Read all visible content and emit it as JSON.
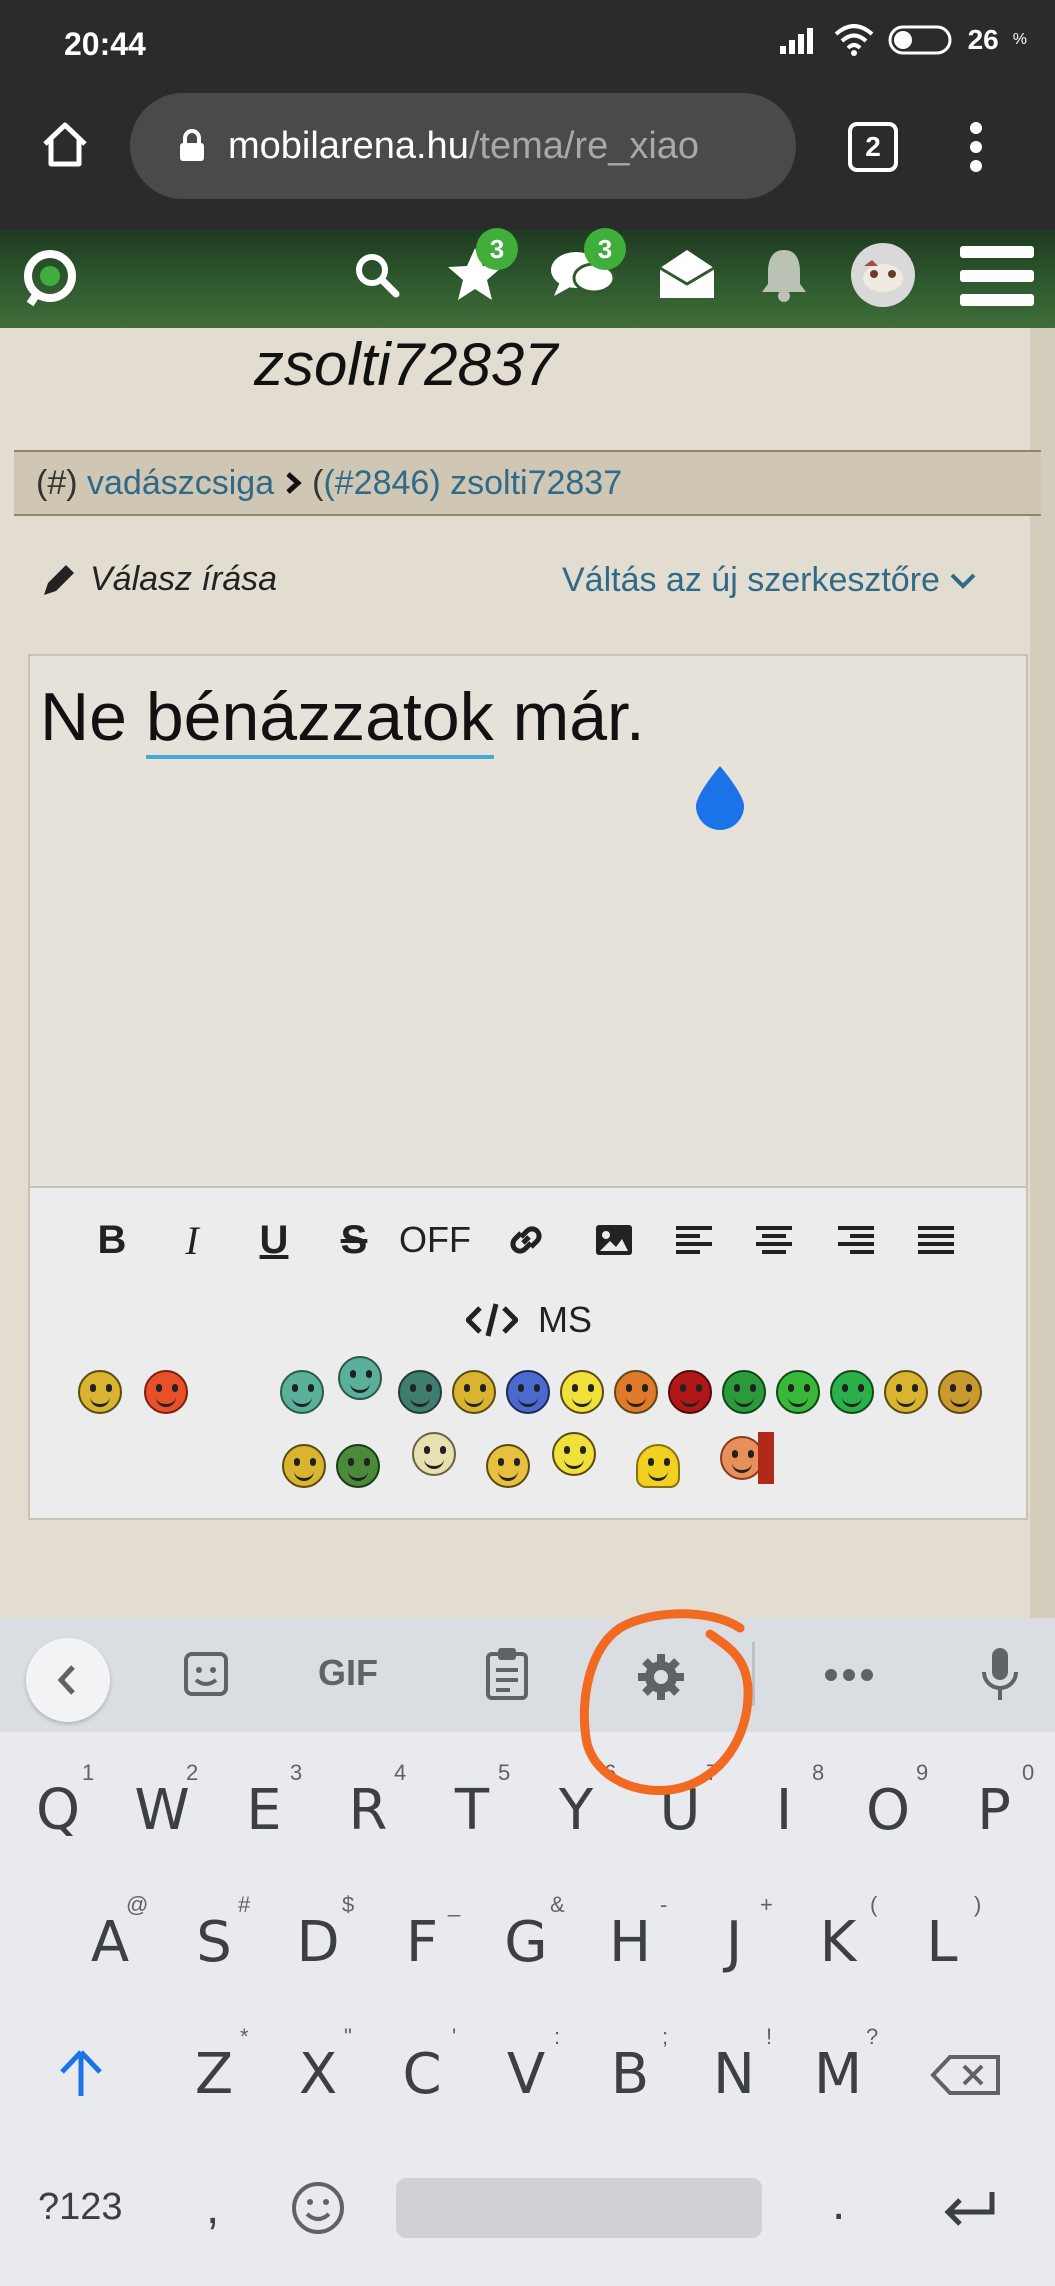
{
  "status_bar": {
    "time": "20:44",
    "battery": "26"
  },
  "browser": {
    "url_host": "mobilarena.hu",
    "url_path": "/tema/re_xiao",
    "tab_count": "2"
  },
  "site_header": {
    "favorites_badge": "3",
    "messages_badge": "3"
  },
  "page": {
    "username_title": "zsolti72837",
    "breadcrumb": {
      "hash_prefix": "(#)",
      "author": "vadászcsiga",
      "post_ref": "(#2846)",
      "reply_to": "zsolti72837"
    },
    "reply_label": "Válasz írása",
    "switch_editor_label": "Váltás az új szerkesztőre",
    "editor": {
      "word1": "Ne",
      "word2": "bénázzatok",
      "word3": "már."
    },
    "toolbar": {
      "off_label": "OFF",
      "ms_label": "MS"
    }
  },
  "keyboard": {
    "toolbar_gif": "GIF",
    "row1": [
      "Q",
      "W",
      "E",
      "R",
      "T",
      "Y",
      "U",
      "I",
      "O",
      "P"
    ],
    "row1_hints": [
      "1",
      "2",
      "3",
      "4",
      "5",
      "6",
      "7",
      "8",
      "9",
      "0"
    ],
    "row2": [
      "A",
      "S",
      "D",
      "F",
      "G",
      "H",
      "J",
      "K",
      "L"
    ],
    "row2_hints": [
      "@",
      "#",
      "$",
      "_",
      "&",
      "-",
      "+",
      "(",
      ")"
    ],
    "row3": [
      "Z",
      "X",
      "C",
      "V",
      "B",
      "N",
      "M"
    ],
    "row3_hints": [
      "*",
      "\"",
      "'",
      ":",
      ";",
      "!",
      "?"
    ],
    "symbols_key": "?123",
    "comma_key": ",",
    "period_key": "."
  },
  "colors": {
    "annotation": "#f26a22",
    "link": "#2f6a8a",
    "badge": "#3fae3a",
    "cursor_handle": "#1a73e8"
  }
}
